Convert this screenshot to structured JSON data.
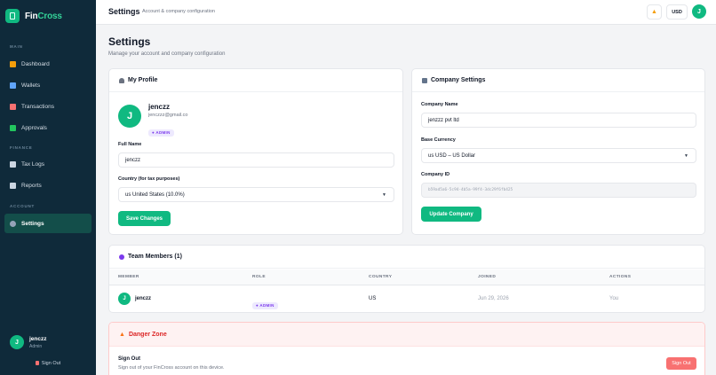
{
  "brand": {
    "name_part1": "Fin",
    "name_part2": "Cross",
    "icon": "wallet-card-icon"
  },
  "sidebar": {
    "sections": [
      {
        "label": "MAIN",
        "items": [
          {
            "label": "Dashboard",
            "icon": "dashboard-icon",
            "color": "#f59e0b"
          },
          {
            "label": "Wallets",
            "icon": "wallet-icon",
            "color": "#60a5fa"
          },
          {
            "label": "Transactions",
            "icon": "transactions-icon",
            "color": "#f87171"
          },
          {
            "label": "Approvals",
            "icon": "check-icon",
            "color": "#22c55e"
          }
        ]
      },
      {
        "label": "FINANCE",
        "items": [
          {
            "label": "Tax Logs",
            "icon": "clipboard-icon",
            "color": "#cbd5e1"
          },
          {
            "label": "Reports",
            "icon": "report-icon",
            "color": "#cbd5e1"
          }
        ]
      },
      {
        "label": "ACCOUNT",
        "items": [
          {
            "label": "Settings",
            "icon": "gear-icon",
            "color": "#94a3b8",
            "active": true
          }
        ]
      }
    ],
    "user": {
      "initial": "J",
      "name": "jenczz",
      "role": "Admin"
    },
    "sign_out": "Sign Out"
  },
  "header": {
    "title": "Settings",
    "subtitle": "Account & company configuration",
    "bell_icon": "bell-icon",
    "currency": "USD",
    "avatar_initial": "J"
  },
  "page": {
    "title": "Settings",
    "subtitle": "Manage your account and company configuration"
  },
  "profile": {
    "heading": "My Profile",
    "icon": "user-icon",
    "avatar_initial": "J",
    "name": "jenczz",
    "email": "jenczzz@gmail.co",
    "badge": "● ADMIN",
    "full_name_label": "Full Name",
    "full_name_value": "jenczz",
    "country_label": "Country (for tax purposes)",
    "country_value": "us United States (10.0%)",
    "save_label": "Save Changes"
  },
  "company": {
    "heading": "Company Settings",
    "icon": "building-icon",
    "name_label": "Company Name",
    "name_value": "jenzzz pvt ltd",
    "currency_label": "Base Currency",
    "currency_value": "us USD – US Dollar",
    "id_label": "Company ID",
    "id_value": "b59ad5a6-5c94-4b5a-99f4-3dc29f6fb425",
    "update_label": "Update Company"
  },
  "team": {
    "heading": "Team Members (1)",
    "icon": "team-icon",
    "columns": [
      "MEMBER",
      "ROLE",
      "COUNTRY",
      "JOINED",
      "ACTIONS"
    ],
    "rows": [
      {
        "initial": "J",
        "member": "jenczz",
        "role": "● ADMIN",
        "country": "US",
        "joined": "Jun 29, 2026",
        "actions": "You"
      }
    ]
  },
  "danger": {
    "heading": "Danger Zone",
    "icon": "warning-icon",
    "sign_out_title": "Sign Out",
    "sign_out_desc": "Sign out of your FinCross account on this device.",
    "sign_out_button": "Sign Out"
  },
  "colors": {
    "accent": "#10b981",
    "sidebar": "#0f2a3a",
    "danger": "#dc2626"
  }
}
